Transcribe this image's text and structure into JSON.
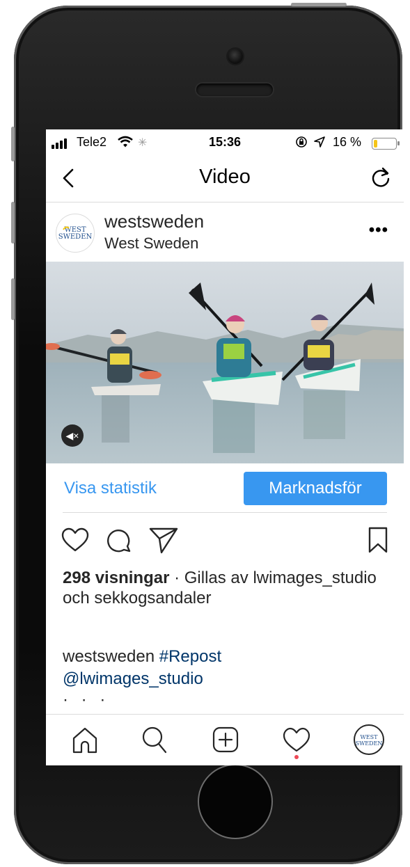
{
  "status_bar": {
    "carrier": "Tele2",
    "time": "15:36",
    "battery_percent": "16 %",
    "battery_level": 0.16,
    "battery_color": "#f5c518"
  },
  "nav": {
    "title": "Video",
    "back_icon": "chevron-left-icon",
    "refresh_icon": "refresh-icon"
  },
  "post": {
    "username": "westsweden",
    "subtitle": "West Sweden",
    "avatar_logo": "WEST SWEDEN",
    "more_icon": "more-icon",
    "mute_icon": "speaker-muted-icon"
  },
  "actions": {
    "stats_link": "Visa statistik",
    "promote_button": "Marknadsför"
  },
  "engagement": {
    "views": "298 visningar",
    "liked_by_prefix": " · Gillas av ",
    "liker_1": "lwimages_studio",
    "and_word": " och ",
    "liker_2": "sekkogsandaler"
  },
  "caption": {
    "author": "westsweden",
    "hashtag": "#Repost",
    "mention": "@lwimages_studio",
    "more": "· · ·"
  },
  "tabs": [
    "home-icon",
    "search-icon",
    "add-post-icon",
    "activity-heart-icon",
    "profile-avatar"
  ],
  "colors": {
    "accent": "#3897f0",
    "link_dark": "#003569",
    "notification": "#ed4956"
  }
}
